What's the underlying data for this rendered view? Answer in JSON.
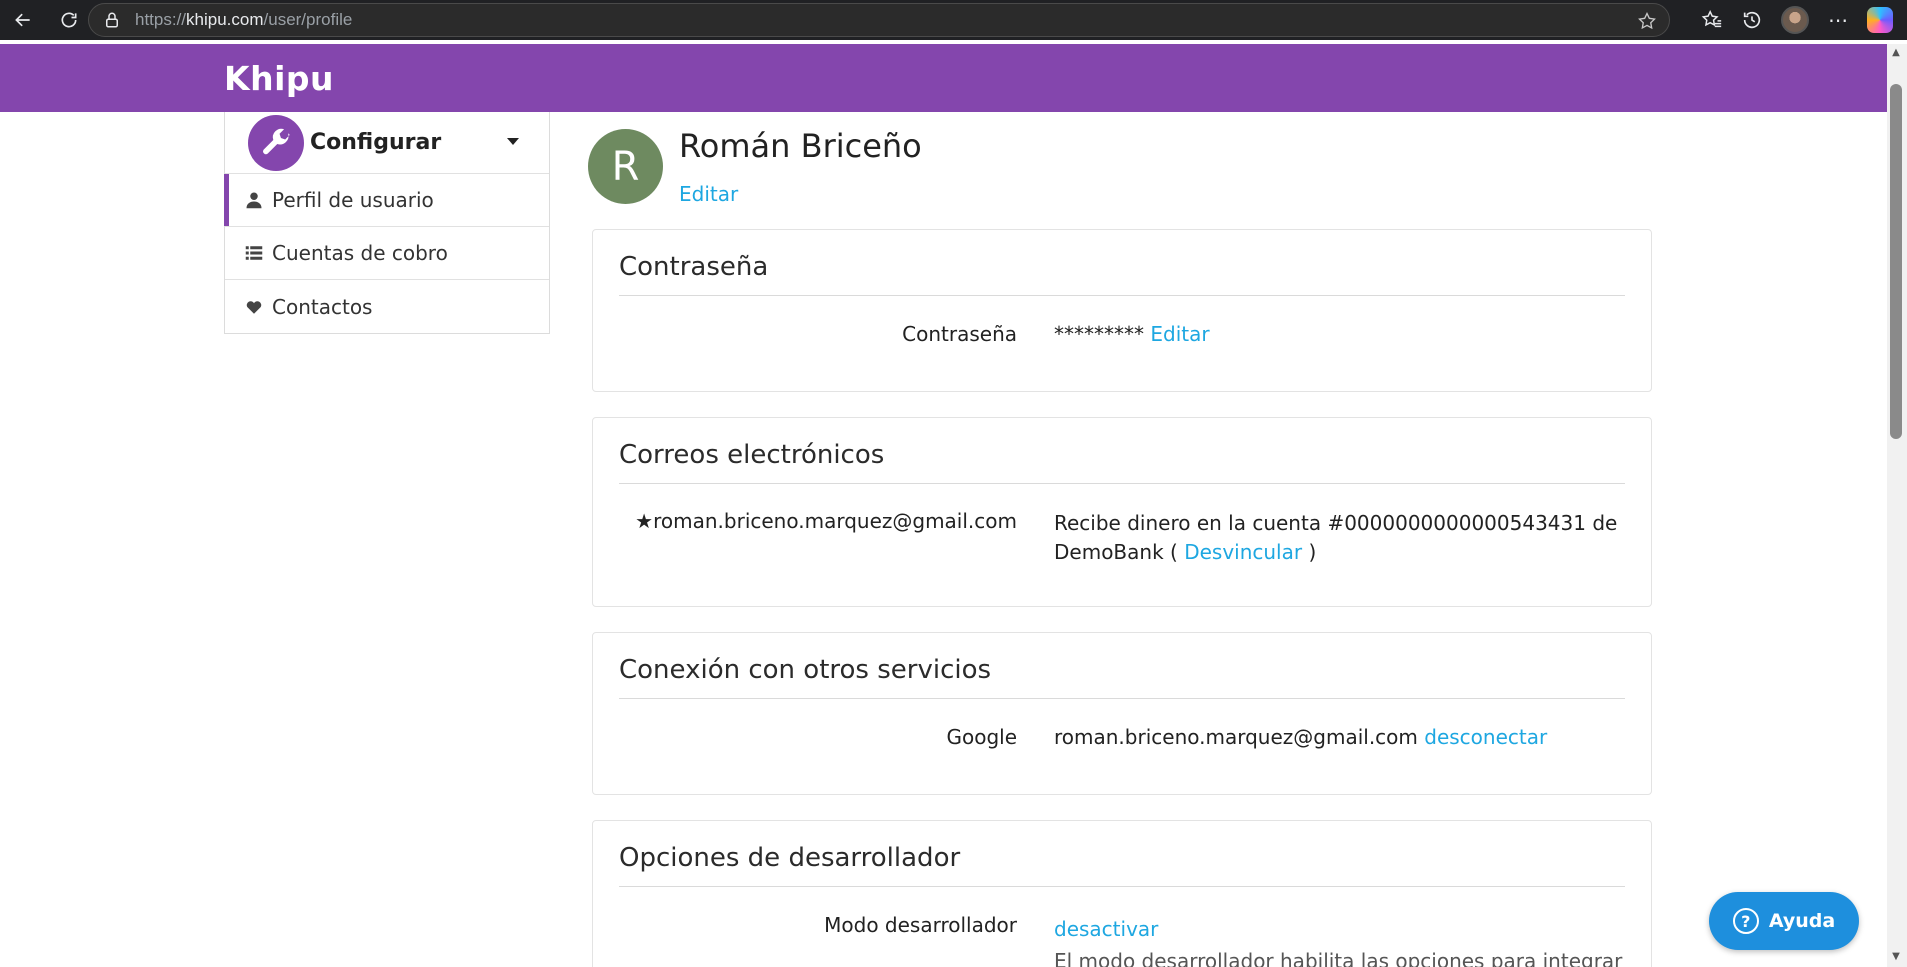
{
  "browser": {
    "url_prefix": "https://",
    "url_host": "khipu.com",
    "url_path": "/user/profile"
  },
  "header": {
    "logo_text": "Khipu",
    "brand_color": "#8446ad"
  },
  "sidebar": {
    "title": "Configurar",
    "items": [
      {
        "label": "Perfil de usuario",
        "icon": "user-icon",
        "active": true
      },
      {
        "label": "Cuentas de cobro",
        "icon": "list-icon",
        "active": false
      },
      {
        "label": "Contactos",
        "icon": "heart-icon",
        "active": false
      }
    ]
  },
  "profile": {
    "avatar_initial": "R",
    "name": "Román Briceño",
    "edit_label": "Editar"
  },
  "sections": {
    "password": {
      "title": "Contraseña",
      "label": "Contraseña",
      "masked": "*********",
      "edit_label": "Editar"
    },
    "emails": {
      "title": "Correos electrónicos",
      "star": "★",
      "email": "roman.briceno.marquez@gmail.com",
      "desc_line1": "Recibe dinero en la cuenta #0000000000000543431 de",
      "desc_line2_prefix": "DemoBank ( ",
      "unlink_label": "Desvincular",
      "desc_line2_suffix": " )"
    },
    "connections": {
      "title": "Conexión con otros servicios",
      "label": "Google",
      "email": "roman.briceno.marquez@gmail.com",
      "disconnect_label": "desconectar"
    },
    "developer": {
      "title": "Opciones de desarrollador",
      "label": "Modo desarrollador",
      "deactivate_label": "desactivar",
      "desc": "El modo desarrollador habilita las opciones para integrar"
    }
  },
  "help": {
    "label": "Ayuda",
    "color": "#1e8fdd"
  },
  "accent_link_color": "#1ea7e1"
}
